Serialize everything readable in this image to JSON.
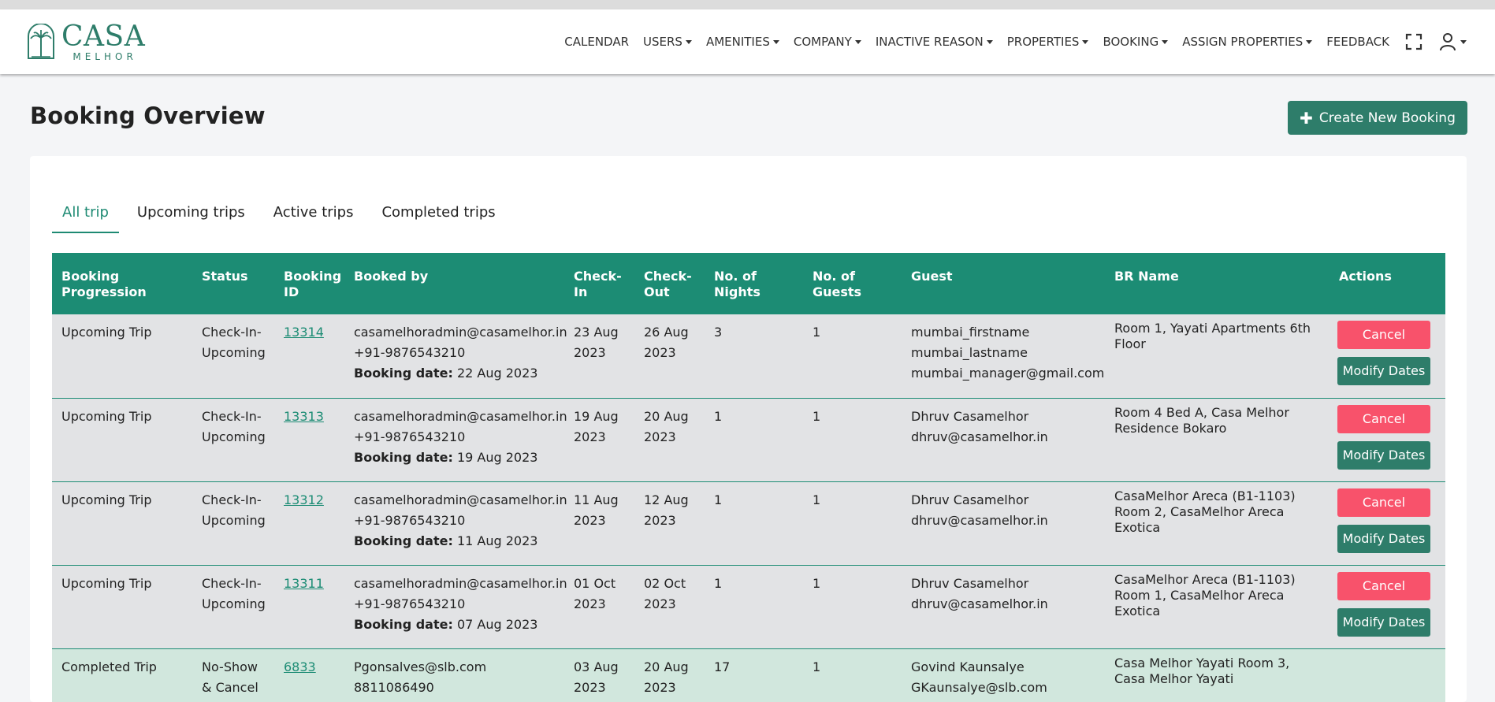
{
  "brand": {
    "name": "CASA",
    "sub": "MELHOR"
  },
  "nav": [
    {
      "label": "CALENDAR",
      "dropdown": false
    },
    {
      "label": "USERS",
      "dropdown": true
    },
    {
      "label": "AMENITIES",
      "dropdown": true
    },
    {
      "label": "COMPANY",
      "dropdown": true
    },
    {
      "label": "INACTIVE REASON",
      "dropdown": true
    },
    {
      "label": "PROPERTIES",
      "dropdown": true
    },
    {
      "label": "BOOKING",
      "dropdown": true
    },
    {
      "label": "ASSIGN PROPERTIES",
      "dropdown": true
    },
    {
      "label": "FEEDBACK",
      "dropdown": false
    }
  ],
  "page": {
    "title": "Booking Overview",
    "create_label": "Create New Booking"
  },
  "tabs": [
    "All trip",
    "Upcoming trips",
    "Active trips",
    "Completed trips"
  ],
  "active_tab": "All trip",
  "table": {
    "headers": [
      [
        "Booking",
        "Progression"
      ],
      [
        "Status"
      ],
      [
        "Booking",
        "ID"
      ],
      [
        "Booked by"
      ],
      [
        "Check-",
        "In"
      ],
      [
        "Check-",
        "Out"
      ],
      [
        "No. of",
        "Nights"
      ],
      [
        "No. of",
        "Guests"
      ],
      [
        "Guest"
      ],
      [
        "BR Name"
      ],
      [
        "Actions"
      ]
    ],
    "booking_date_label": "Booking date:",
    "cancel_label": "Cancel",
    "modify_label": "Modify Dates",
    "rows": [
      {
        "progression": "Upcoming Trip",
        "status": [
          "Check-In-",
          "Upcoming"
        ],
        "booking_id": "13314",
        "booked_by": "casamelhoradmin@casamelhor.in",
        "phone": "+91-9876543210",
        "booking_date": "22 Aug 2023",
        "check_in": [
          "23 Aug",
          "2023"
        ],
        "check_out": [
          "26 Aug",
          "2023"
        ],
        "nights": "3",
        "guests": "1",
        "guest": [
          "mumbai_firstname",
          "mumbai_lastname",
          "mumbai_manager@gmail.com"
        ],
        "br_name": "Room 1, Yayati Apartments 6th Floor",
        "kind": "upcoming"
      },
      {
        "progression": "Upcoming Trip",
        "status": [
          "Check-In-",
          "Upcoming"
        ],
        "booking_id": "13313",
        "booked_by": "casamelhoradmin@casamelhor.in",
        "phone": "+91-9876543210",
        "booking_date": "19 Aug 2023",
        "check_in": [
          "19 Aug",
          "2023"
        ],
        "check_out": [
          "20 Aug",
          "2023"
        ],
        "nights": "1",
        "guests": "1",
        "guest": [
          "Dhruv Casamelhor",
          "dhruv@casamelhor.in"
        ],
        "br_name": "Room 4 Bed A, Casa Melhor Residence Bokaro",
        "kind": "upcoming"
      },
      {
        "progression": "Upcoming Trip",
        "status": [
          "Check-In-",
          "Upcoming"
        ],
        "booking_id": "13312",
        "booked_by": "casamelhoradmin@casamelhor.in",
        "phone": "+91-9876543210",
        "booking_date": "11 Aug 2023",
        "check_in": [
          "11 Aug",
          "2023"
        ],
        "check_out": [
          "12 Aug",
          "2023"
        ],
        "nights": "1",
        "guests": "1",
        "guest": [
          "Dhruv Casamelhor",
          "dhruv@casamelhor.in"
        ],
        "br_name": "CasaMelhor Areca (B1-1103) Room 2, CasaMelhor Areca Exotica",
        "kind": "upcoming"
      },
      {
        "progression": "Upcoming Trip",
        "status": [
          "Check-In-",
          "Upcoming"
        ],
        "booking_id": "13311",
        "booked_by": "casamelhoradmin@casamelhor.in",
        "phone": "+91-9876543210",
        "booking_date": "07 Aug 2023",
        "check_in": [
          "01 Oct",
          "2023"
        ],
        "check_out": [
          "02 Oct",
          "2023"
        ],
        "nights": "1",
        "guests": "1",
        "guest": [
          "Dhruv Casamelhor",
          "dhruv@casamelhor.in"
        ],
        "br_name": "CasaMelhor Areca (B1-1103) Room 1, CasaMelhor Areca Exotica",
        "kind": "upcoming"
      },
      {
        "progression": "Completed Trip",
        "status": [
          "No-Show",
          "& Cancel"
        ],
        "booking_id": "6833",
        "booked_by": "Pgonsalves@slb.com",
        "phone": "8811086490",
        "booking_date": "",
        "check_in": [
          "03 Aug",
          "2023"
        ],
        "check_out": [
          "20 Aug",
          "2023"
        ],
        "nights": "17",
        "guests": "1",
        "guest": [
          "Govind Kaunsalye",
          "GKaunsalye@slb.com"
        ],
        "br_name": "Casa Melhor Yayati Room 3, Casa Melhor Yayati",
        "kind": "completed"
      }
    ]
  },
  "colors": {
    "brand": "#2e7d6a",
    "header": "#1c8c74",
    "cancel": "#f8526b",
    "upcoming_row": "#e2e3e5",
    "completed_row": "#d1e7dd"
  },
  "icons": {
    "fullscreen": "fullscreen-icon",
    "user": "user-icon"
  }
}
